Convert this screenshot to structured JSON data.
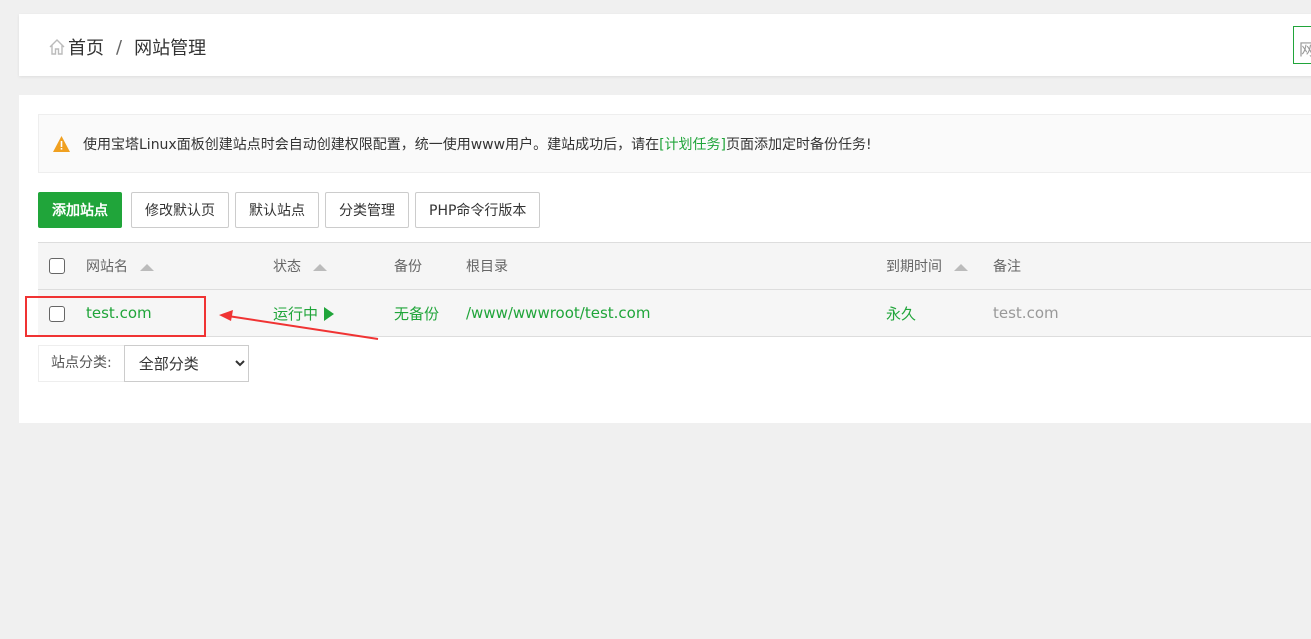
{
  "breadcrumb": {
    "home": "首页",
    "separator": "/",
    "current": "网站管理"
  },
  "search": {
    "placeholder": "网"
  },
  "alert": {
    "text_before": "使用宝塔Linux面板创建站点时会自动创建权限配置，统一使用www用户。建站成功后，请在",
    "link": "[计划任务]",
    "text_after": "页面添加定时备份任务!"
  },
  "toolbar": {
    "add_site": "添加站点",
    "edit_default_page": "修改默认页",
    "default_site": "默认站点",
    "category_manage": "分类管理",
    "php_cli_version": "PHP命令行版本"
  },
  "table": {
    "headers": {
      "name": "网站名",
      "status": "状态",
      "backup": "备份",
      "root": "根目录",
      "expire": "到期时间",
      "note": "备注"
    },
    "rows": [
      {
        "name": "test.com",
        "status": "运行中",
        "backup": "无备份",
        "root": "/www/wwwroot/test.com",
        "expire": "永久",
        "note": "test.com"
      }
    ]
  },
  "filter": {
    "label": "站点分类:",
    "selected": "全部分类"
  },
  "colors": {
    "accent": "#20a53a",
    "highlight": "#f03333"
  }
}
